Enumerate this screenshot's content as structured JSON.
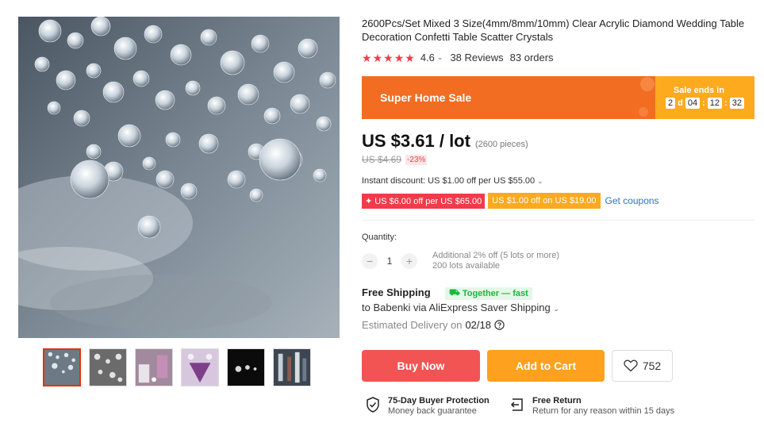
{
  "product": {
    "title": "2600Pcs/Set Mixed 3 Size(4mm/8mm/10mm) Clear Acrylic Diamond Wedding Table Decoration Confetti Table Scatter Crystals",
    "rating": "4.6",
    "rating_stars": 5,
    "reviews": "38 Reviews",
    "orders": "83 orders"
  },
  "sale": {
    "label": "Super Home Sale",
    "ends_label": "Sale ends in",
    "days": "2",
    "days_unit": "d",
    "hours": "04",
    "minutes": "12",
    "seconds": "32",
    "sep": ":"
  },
  "price": {
    "current": "US $3.61 / lot",
    "pieces": "(2600 pieces)",
    "original": "US $4.69",
    "discount": "-23%"
  },
  "promo": {
    "instant_discount": "Instant discount: US $1.00 off per US $55.00",
    "coupon_red": "US $6.00 off per US $65.00",
    "coupon_orange": "US $1.00 off on US $19.00",
    "get_coupons": "Get coupons"
  },
  "quantity": {
    "label": "Quantity:",
    "value": "1",
    "minus": "−",
    "plus": "+",
    "note_line1": "Additional 2% off (5 lots or more)",
    "note_line2": "200 lots available"
  },
  "shipping": {
    "title": "Free Shipping",
    "together": "Together — fast",
    "destination": "to Babenki via AliExpress Saver Shipping",
    "estimated_label": "Estimated Delivery on",
    "estimated_date": "02/18"
  },
  "actions": {
    "buy_now": "Buy Now",
    "add_to_cart": "Add to Cart",
    "wishlist_count": "752"
  },
  "guarantees": [
    {
      "title": "75-Day Buyer Protection",
      "subtitle": "Money back guarantee"
    },
    {
      "title": "Free Return",
      "subtitle": "Return for any reason within 15 days"
    }
  ],
  "icons": [
    "star-icon",
    "chevron-down-icon",
    "question-icon",
    "heart-icon",
    "shield-check-icon",
    "return-icon",
    "truck-icon"
  ],
  "colors": {
    "sale_orange": "#f26d22",
    "sale_yellow": "#fdaa1f",
    "buy_red": "#f25454",
    "cart_orange": "#fda11f",
    "star_red": "#f23b4a",
    "link_blue": "#3172c5",
    "together_green": "#1ab83a"
  }
}
